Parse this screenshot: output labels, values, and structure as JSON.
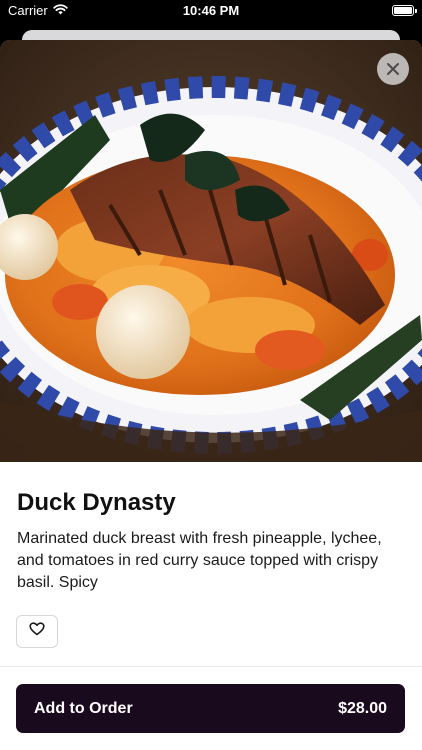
{
  "status_bar": {
    "carrier": "Carrier",
    "time": "10:46 PM"
  },
  "item": {
    "name": "Duck Dynasty",
    "description": "Marinated duck breast with fresh pineapple, lychee, and tomatoes in red curry sauce topped with crispy basil. Spicy",
    "image_alt": "Duck curry dish photo"
  },
  "actions": {
    "add_label": "Add to Order",
    "price": "$28.00"
  },
  "icons": {
    "close": "close-icon",
    "favorite": "heart-icon",
    "wifi": "wifi-icon",
    "battery": "battery-icon"
  },
  "colors": {
    "accent": "#1a0a1e",
    "sheet": "#ffffff",
    "background": "#000000"
  }
}
